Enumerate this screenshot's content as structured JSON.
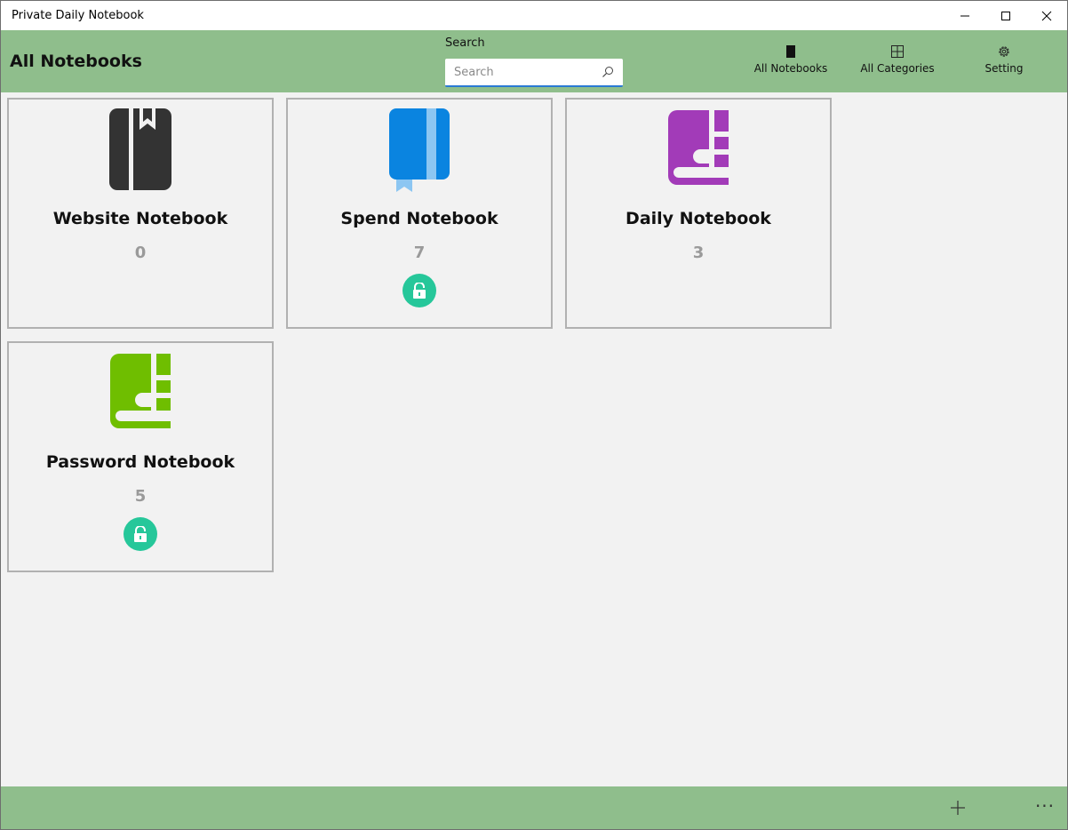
{
  "window": {
    "title": "Private Daily Notebook"
  },
  "header": {
    "page_title": "All Notebooks",
    "search_label": "Search",
    "search_placeholder": "Search",
    "search_value": "",
    "nav": [
      {
        "label": "All Notebooks",
        "icon": "notebook-icon"
      },
      {
        "label": "All Categories",
        "icon": "grid-icon"
      },
      {
        "label": "Setting",
        "icon": "gear-icon"
      }
    ]
  },
  "notebooks": [
    {
      "title": "Website Notebook",
      "count": "0",
      "locked": false,
      "icon": "bookmark-notebook-icon",
      "color": "#333333"
    },
    {
      "title": "Spend Notebook",
      "count": "7",
      "locked": true,
      "icon": "blue-notebook-icon",
      "color": "#0a84e0"
    },
    {
      "title": "Daily Notebook",
      "count": "3",
      "locked": false,
      "icon": "purple-book-icon",
      "color": "#a23bb8"
    },
    {
      "title": "Password Notebook",
      "count": "5",
      "locked": true,
      "icon": "green-book-icon",
      "color": "#6fbe00"
    }
  ],
  "bottombar": {
    "add_icon": "plus-icon",
    "more_label": "···"
  },
  "colors": {
    "accent": "#8fbe8c",
    "lock": "#26c79a",
    "search_underline": "#2a7ad4"
  }
}
